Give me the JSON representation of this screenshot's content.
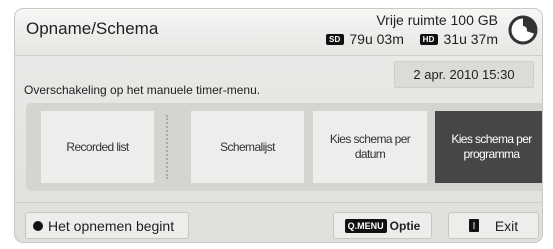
{
  "header": {
    "title": "Opname/Schema",
    "free_space": "Vrije ruimte 100 GB",
    "sd_tag": "SD",
    "sd_time": "79u 03m",
    "hd_tag": "HD",
    "hd_time": "31u 37m",
    "disc_icon": "disc-usage-pie-icon",
    "disc_used_fraction": 0.3
  },
  "date": "2 apr. 2010 15:30",
  "message": "Overschakeling op het manuele timer-menu.",
  "menu": {
    "items": [
      {
        "label": "Recorded list"
      },
      {
        "label": "Schemalijst"
      },
      {
        "label": "Kies schema per datum"
      },
      {
        "label": "Kies schema per programma",
        "selected": true
      }
    ]
  },
  "footer": {
    "record_label": "Het opnemen begint",
    "record_icon": "record-dot-icon",
    "menu_key": "Q.MENU",
    "option_label": "Optie",
    "exit_icon": "exit-key-icon",
    "exit_label": "Exit"
  },
  "colors": {
    "panel": "#e6e5e2",
    "selected_item": "#464646",
    "item": "#ededec"
  }
}
